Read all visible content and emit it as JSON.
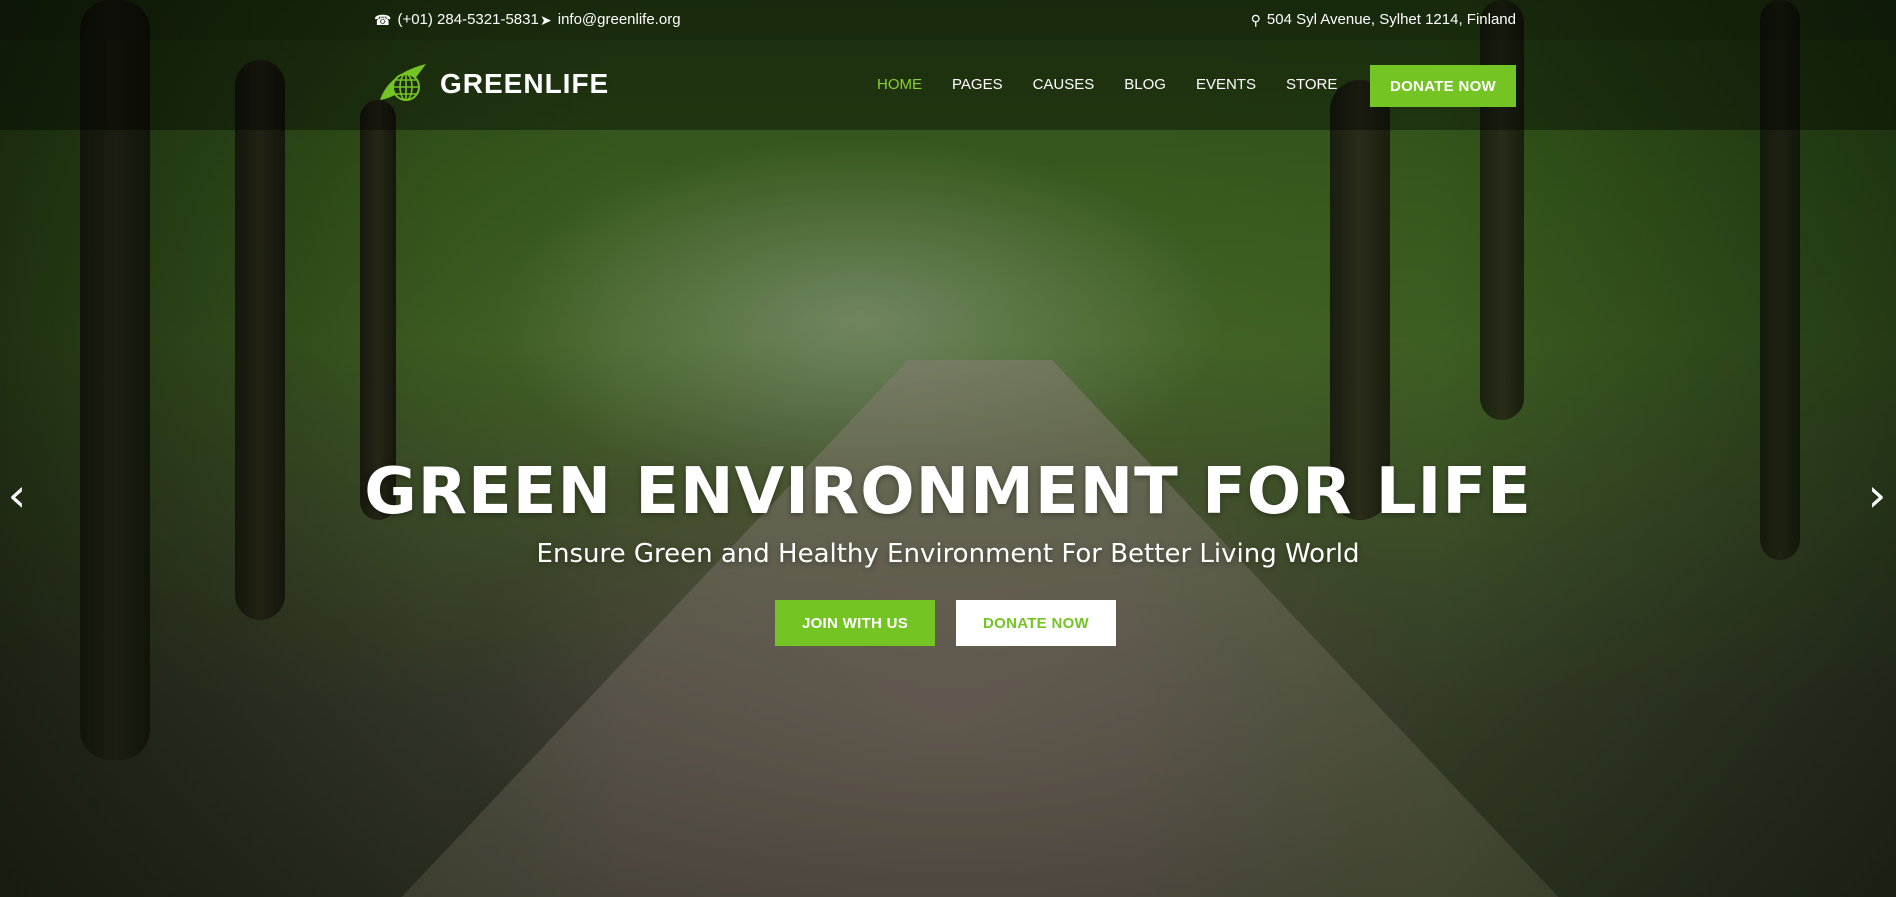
{
  "topbar": {
    "phone": "(+01) 284-5321-5831",
    "email": "info@greenlife.org",
    "address": "504 Syl Avenue, Sylhet 1214, Finland",
    "phone_icon": "phone-icon",
    "email_icon": "paper-plane-icon",
    "address_icon": "map-marker-icon"
  },
  "brand": {
    "name": "GREENLIFE",
    "logo_icon": "globe-leaf-logo",
    "accent_color": "#74c424"
  },
  "nav": {
    "items": [
      {
        "label": "HOME",
        "active": true
      },
      {
        "label": "PAGES",
        "active": false
      },
      {
        "label": "CAUSES",
        "active": false
      },
      {
        "label": "BLOG",
        "active": false
      },
      {
        "label": "EVENTS",
        "active": false
      },
      {
        "label": "STORE",
        "active": false
      }
    ],
    "donate_label": "DONATE NOW"
  },
  "hero": {
    "title": "GREEN ENVIRONMENT FOR LIFE",
    "subtitle": "Ensure Green and Healthy Environment For Better Living World",
    "join_label": "JOIN WITH US",
    "donate_label": "DONATE NOW",
    "prev_icon": "chevron-left-icon",
    "next_icon": "chevron-right-icon"
  }
}
